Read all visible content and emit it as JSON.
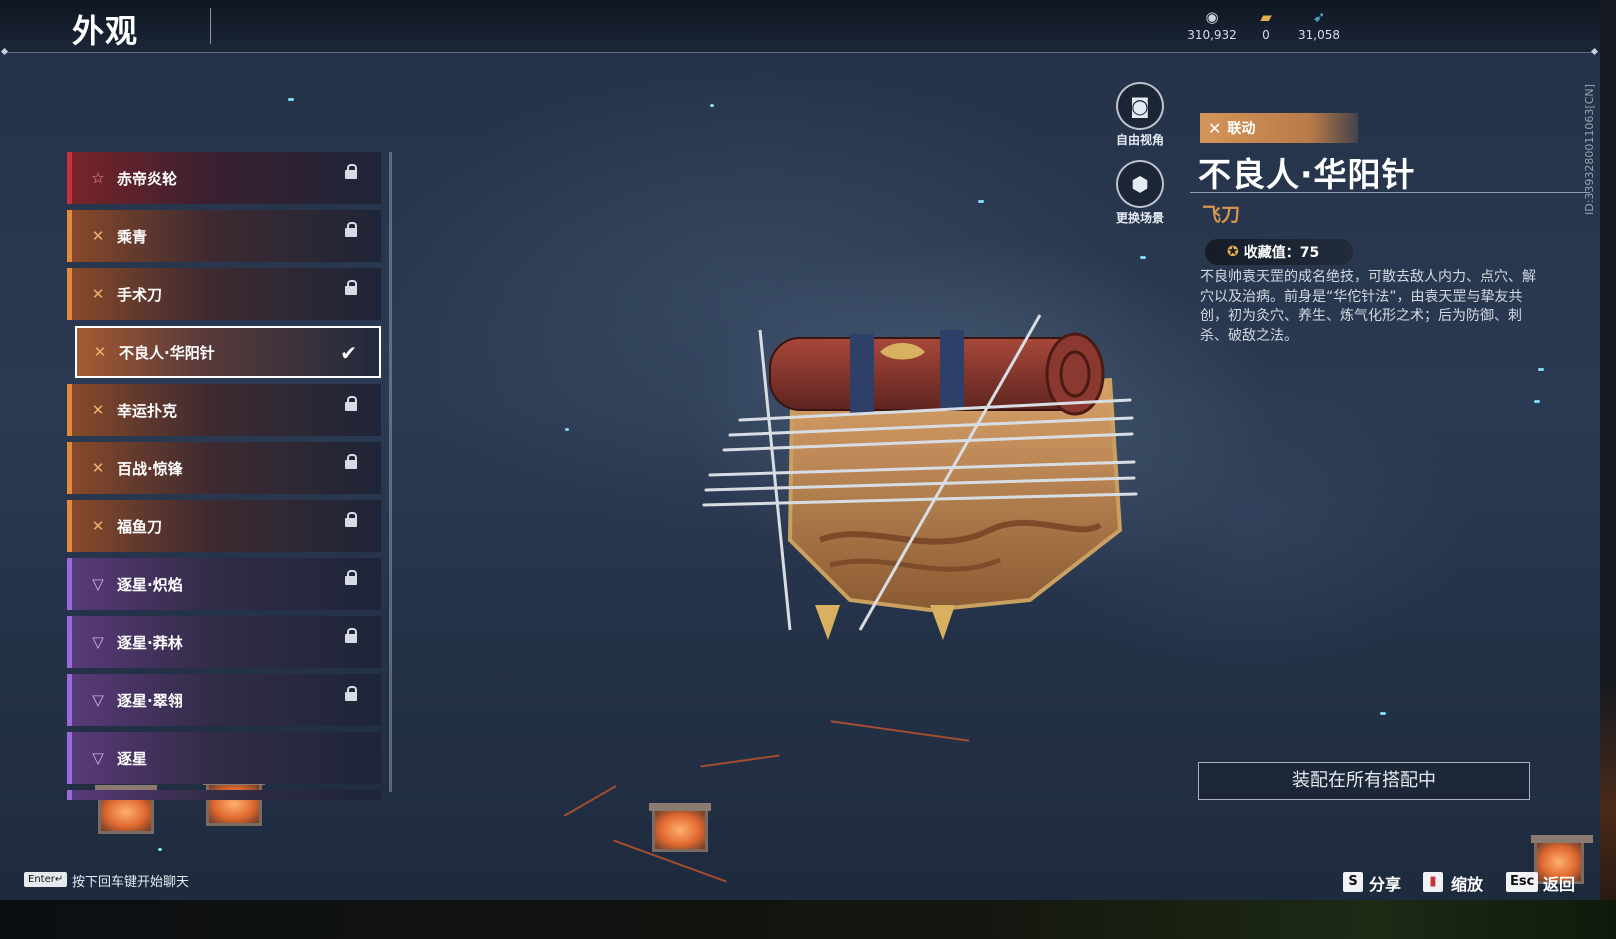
{
  "header": {
    "title": "外观",
    "currencies": [
      {
        "icon": "coin-icon",
        "value": "310,932"
      },
      {
        "icon": "ticket-icon",
        "value": "0"
      },
      {
        "icon": "feather-icon",
        "value": "31,058"
      }
    ]
  },
  "list": {
    "items": [
      {
        "label": "赤帝炎轮",
        "icon": "star-icon",
        "rarity_color": "#c8323a",
        "state": "locked"
      },
      {
        "label": "乘青",
        "icon": "crossed-blades-icon",
        "rarity_color": "#e08a3a",
        "state": "locked"
      },
      {
        "label": "手术刀",
        "icon": "crossed-blades-icon",
        "rarity_color": "#e08a3a",
        "state": "locked"
      },
      {
        "label": "不良人·华阳针",
        "icon": "crossed-blades-icon",
        "rarity_color": "#e08a3a",
        "state": "selected"
      },
      {
        "label": "幸运扑克",
        "icon": "crossed-blades-icon",
        "rarity_color": "#e08a3a",
        "state": "locked"
      },
      {
        "label": "百战·惊锋",
        "icon": "crossed-blades-icon",
        "rarity_color": "#e08a3a",
        "state": "locked"
      },
      {
        "label": "福鱼刀",
        "icon": "crossed-blades-icon",
        "rarity_color": "#e08a3a",
        "state": "locked"
      },
      {
        "label": "逐星·炽焰",
        "icon": "trident-icon",
        "rarity_color": "#9a6ad8",
        "state": "locked"
      },
      {
        "label": "逐星·莽林",
        "icon": "trident-icon",
        "rarity_color": "#9a6ad8",
        "state": "locked"
      },
      {
        "label": "逐星·翠翎",
        "icon": "trident-icon",
        "rarity_color": "#9a6ad8",
        "state": "locked"
      },
      {
        "label": "逐星",
        "icon": "trident-icon",
        "rarity_color": "#9a6ad8",
        "state": "none"
      }
    ]
  },
  "camera": {
    "free_view_label": "自由视角",
    "change_scene_label": "更换场景"
  },
  "detail": {
    "tag": "联动",
    "title": "不良人·华阳针",
    "type": "飞刀",
    "collection_value": "收藏值：75",
    "description": "不良帅袁天罡的成名绝技，可散去敌人内力、点穴、解穴以及治病。前身是“华佗针法”，由袁天罡与挚友共创，初为灸穴、养生、炼气化形之术；后为防御、刺杀、破敌之法。",
    "equip_all_label": "装配在所有搭配中",
    "id_text": "ID:3393280011063[CN]"
  },
  "footer": {
    "enter_key": "Enter↵",
    "chat_hint": "按下回车键开始聊天",
    "share_key": "S",
    "share_label": "分享",
    "zoom_label": "缩放",
    "back_key": "Esc",
    "back_label": "返回"
  },
  "colors": {
    "accent_orange": "#d8954e",
    "legendary_red": "#c8323a",
    "epic_orange": "#e08a3a",
    "rare_purple": "#9a6ad8"
  }
}
